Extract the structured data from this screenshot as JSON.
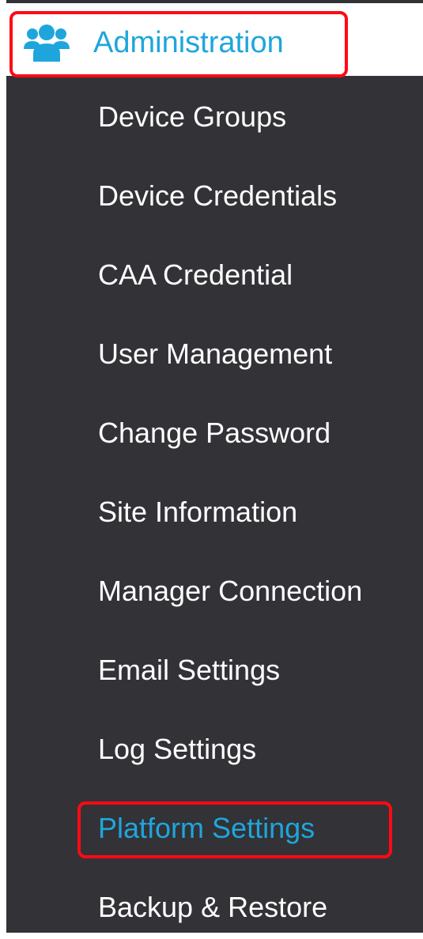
{
  "sidebar": {
    "header": {
      "label": "Administration",
      "icon": "users-group-icon",
      "highlighted": true
    },
    "accent_color": "#1ea6dc",
    "highlight_color": "#ff0a14",
    "background_color": "#333237",
    "items": [
      {
        "label": "Device Groups",
        "active": false
      },
      {
        "label": "Device Credentials",
        "active": false
      },
      {
        "label": "CAA Credential",
        "active": false
      },
      {
        "label": "User Management",
        "active": false
      },
      {
        "label": "Change Password",
        "active": false
      },
      {
        "label": "Site Information",
        "active": false
      },
      {
        "label": "Manager Connection",
        "active": false
      },
      {
        "label": "Email Settings",
        "active": false
      },
      {
        "label": "Log Settings",
        "active": false
      },
      {
        "label": "Platform Settings",
        "active": true,
        "highlighted": true
      },
      {
        "label": "Backup & Restore",
        "active": false
      }
    ]
  }
}
